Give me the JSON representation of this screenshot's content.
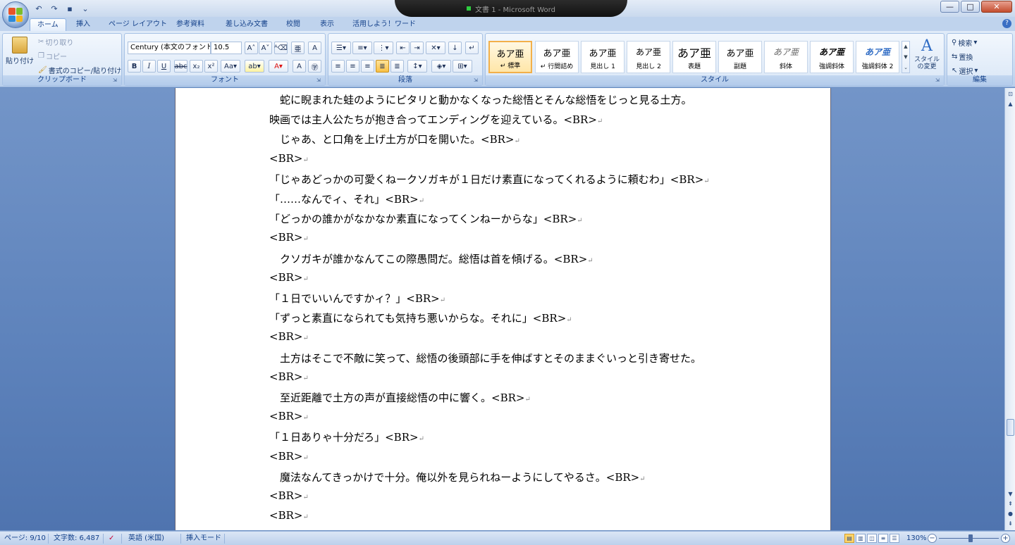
{
  "titlebar": {
    "title": "文書 1 - Microsoft Word",
    "qat": [
      {
        "name": "undo",
        "glyph": "↶"
      },
      {
        "name": "redo",
        "glyph": "↷"
      },
      {
        "name": "save",
        "glyph": "▪"
      },
      {
        "name": "customize",
        "glyph": "⌄"
      }
    ],
    "controls": {
      "minimize": "—",
      "maximize": "□",
      "close": "✕"
    }
  },
  "tabs": [
    {
      "label": "ホーム",
      "active": true
    },
    {
      "label": "挿入"
    },
    {
      "label": "ページ レイアウト"
    },
    {
      "label": "参考資料"
    },
    {
      "label": "差し込み文書"
    },
    {
      "label": "校閲"
    },
    {
      "label": "表示"
    },
    {
      "label": "活用しよう！ワード"
    }
  ],
  "ribbon": {
    "clipboard": {
      "label": "クリップボード",
      "paste": "貼り付け",
      "cut": "切り取り",
      "copy": "コピー",
      "format_painter": "書式のコピー/貼り付け"
    },
    "font": {
      "label": "フォント",
      "font_name": "Century (本文のフォント",
      "font_size": "10.5"
    },
    "paragraph": {
      "label": "段落"
    },
    "styles": {
      "label": "スタイル",
      "items": [
        {
          "sample": "あア亜",
          "name": "↵ 標準",
          "selected": true
        },
        {
          "sample": "あア亜",
          "name": "↵ 行間詰め"
        },
        {
          "sample": "あア亜",
          "name": "見出し 1"
        },
        {
          "sample": "あア亜",
          "name": "見出し 2"
        },
        {
          "sample": "あア亜",
          "name": "表題"
        },
        {
          "sample": "あア亜",
          "name": "副題"
        },
        {
          "sample": "あア亜",
          "name": "斜体"
        },
        {
          "sample": "あア亜",
          "name": "強調斜体"
        },
        {
          "sample": "あア亜",
          "name": "強調斜体 2"
        }
      ],
      "change_styles": "スタイルの変更"
    },
    "editing": {
      "label": "編集",
      "find": "検索",
      "replace": "置換",
      "select": "選択"
    }
  },
  "document": {
    "lines": [
      "　蛇に睨まれた蛙のようにピタリと動かなくなった総悟とそんな総悟をじっと見る土方。",
      "映画では主人公たちが抱き合ってエンディングを迎えている。<BR>",
      "　じゃあ、と口角を上げ土方が口を開いた。<BR>",
      "<BR>",
      "「じゃあどっかの可愛くねークソガキが１日だけ素直になってくれるように頼むわ」<BR>",
      "「……なんでィ、それ」<BR>",
      "「どっかの誰かがなかなか素直になってくンねーからな」<BR>",
      "<BR>",
      "　クソガキが誰かなんてこの際愚問だ。総悟は首を傾げる。<BR>",
      "<BR>",
      "「１日でいいんですかィ？」<BR>",
      "「ずっと素直になられても気持ち悪いからな。それに」<BR>",
      "<BR>",
      "　土方はそこで不敵に笑って、総悟の後頭部に手を伸ばすとそのままぐいっと引き寄せた。",
      "<BR>",
      "　至近距離で土方の声が直接総悟の中に響く。<BR>",
      "<BR>",
      "「１日ありゃ十分だろ」<BR>",
      "<BR>",
      "　魔法なんてきっかけで十分。俺以外を見られねーようにしてやるさ。<BR>",
      "<BR>",
      "<BR>"
    ],
    "para_marks": [
      false,
      true,
      true,
      true,
      true,
      true,
      true,
      true,
      true,
      true,
      true,
      true,
      true,
      false,
      true,
      true,
      true,
      true,
      true,
      true,
      true,
      true
    ]
  },
  "statusbar": {
    "page": "ページ: 9/10",
    "word_count": "文字数: 6,487",
    "language": "英語 (米国)",
    "mode": "挿入モード",
    "zoom": "130%"
  }
}
